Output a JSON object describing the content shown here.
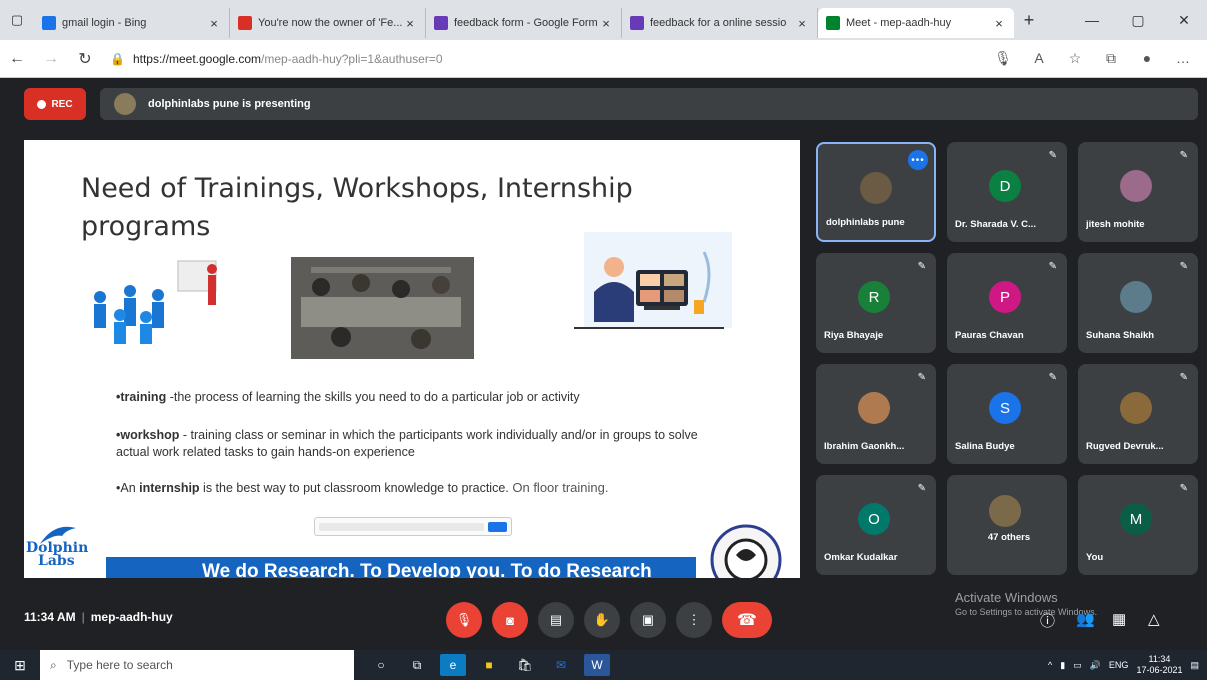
{
  "browser": {
    "tabs": [
      {
        "label": "gmail login - Bing",
        "color": "#1a73e8"
      },
      {
        "label": "You're now the owner of 'Fe...",
        "color": "#d93025"
      },
      {
        "label": "feedback form - Google Form",
        "color": "#673ab7"
      },
      {
        "label": "feedback for a online sessio",
        "color": "#673ab7"
      },
      {
        "label": "Meet - mep-aadh-huy",
        "color": "#00832d"
      }
    ],
    "url_host": "https://meet.google.com",
    "url_path": "/mep-aadh-huy?pli=1&authuser=0"
  },
  "meet": {
    "rec_label": "REC",
    "presenting_text": "dolphinlabs pune is presenting",
    "time": "11:34 AM",
    "meeting_code": "mep-aadh-huy",
    "activate_title": "Activate Windows",
    "activate_sub": "Go to Settings to activate Windows."
  },
  "slide": {
    "title": "Need of Trainings, Workshops, Internship programs",
    "b1_bold": "•training",
    "b1_text": " -the process of learning the skills you need to do a particular job or activity",
    "b2_bold": "•workshop",
    "b2_text": " - training class or seminar in which the participants work individually and/or in groups to solve actual work related tasks to gain hands-on experience",
    "b3_pre": "•An ",
    "b3_bold": "internship",
    "b3_text": " is the best way to put classroom knowledge to practice.",
    "b3_floor": " On floor training.",
    "banner": "We do Research. To Develop you. To do Research",
    "logo_line1": "Dolphin",
    "logo_line2": "Labs"
  },
  "participants": [
    {
      "name": "dolphinlabs pune",
      "initial": "",
      "color": "#6b5a44",
      "active": true
    },
    {
      "name": "Dr. Sharada V. C...",
      "initial": "D",
      "color": "#0b8043"
    },
    {
      "name": "jitesh mohite",
      "initial": "",
      "color": "#9c6a8a"
    },
    {
      "name": "Riya Bhayaje",
      "initial": "R",
      "color": "#188038"
    },
    {
      "name": "Pauras Chavan",
      "initial": "P",
      "color": "#d01884"
    },
    {
      "name": "Suhana Shaikh",
      "initial": "",
      "color": "#5c7c8c"
    },
    {
      "name": "Ibrahim Gaonkh...",
      "initial": "",
      "color": "#b07a50"
    },
    {
      "name": "Salina Budye",
      "initial": "S",
      "color": "#1a73e8"
    },
    {
      "name": "Rugved Devruk...",
      "initial": "",
      "color": "#8a6a3a"
    },
    {
      "name": "Omkar Kudalkar",
      "initial": "O",
      "color": "#00796b"
    },
    {
      "name": "47 others",
      "initial": "",
      "color": "#7a6a4a"
    },
    {
      "name": "You",
      "initial": "M",
      "color": "#0b5e45"
    }
  ],
  "taskbar": {
    "search_placeholder": "Type here to search",
    "lang": "ENG",
    "time": "11:34",
    "date": "17-06-2021"
  }
}
